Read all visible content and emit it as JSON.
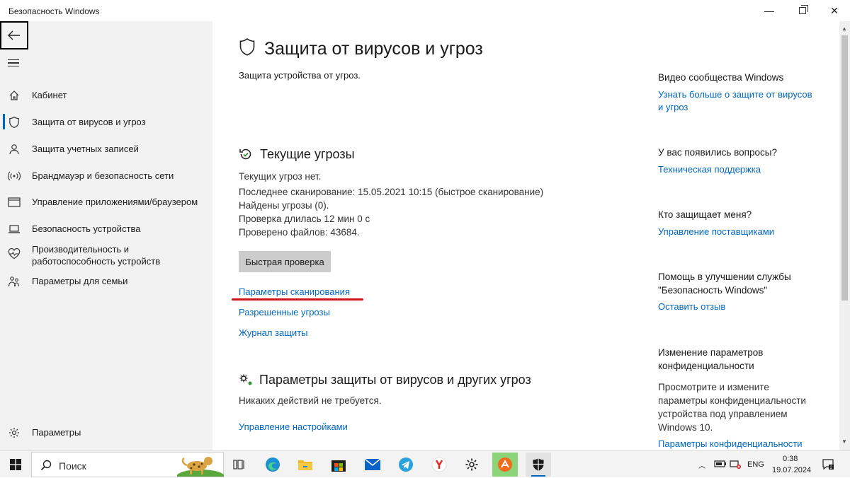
{
  "window": {
    "title": "Безопасность Windows",
    "minimize_glyph": "—",
    "close_glyph": "✕"
  },
  "sidebar": {
    "back_icon": "back-arrow-icon",
    "menu_icon": "hamburger-icon",
    "items": [
      {
        "label": "Кабинет",
        "icon": "home-icon"
      },
      {
        "label": "Защита от вирусов и угроз",
        "icon": "shield-icon",
        "active": true
      },
      {
        "label": "Защита учетных записей",
        "icon": "person-icon"
      },
      {
        "label": "Брандмауэр и безопасность сети",
        "icon": "wifi-icon"
      },
      {
        "label": "Управление приложениями/браузером",
        "icon": "app-window-icon"
      },
      {
        "label": "Безопасность устройства",
        "icon": "laptop-icon"
      },
      {
        "label": "Производительность и работоспособность устройств",
        "icon": "heart-icon"
      },
      {
        "label": "Параметры для семьи",
        "icon": "family-icon"
      }
    ],
    "settings_label": "Параметры"
  },
  "main": {
    "title": "Защита от вирусов и угроз",
    "subtitle": "Защита устройства от угроз.",
    "current_threats": {
      "title": "Текущие угрозы",
      "lines": [
        "Текущих угроз нет.",
        "Последнее сканирование: 15.05.2021 10:15 (быстрое сканирование)",
        "Найдены угрозы (0).",
        "Проверка длилась 12 мин 0 с",
        "Проверено файлов: 43684."
      ],
      "quick_scan_button": "Быстрая проверка",
      "links": [
        "Параметры сканирования",
        "Разрешенные угрозы",
        "Журнал защиты"
      ]
    },
    "protection_settings": {
      "title": "Параметры защиты от вирусов и других угроз",
      "status": "Никаких действий не требуется.",
      "link": "Управление настройками"
    }
  },
  "right_panel": {
    "community_title": "Видео сообщества Windows",
    "community_link": "Узнать больше о защите от вирусов и угроз",
    "questions_title": "У вас появились вопросы?",
    "questions_link": "Техническая поддержка",
    "who_title": "Кто защищает меня?",
    "who_link": "Управление поставщиками",
    "help_title": "Помощь в улучшении службы \"Безопасность Windows\"",
    "help_link": "Оставить отзыв",
    "privacy_title": "Изменение параметров конфиденциальности",
    "privacy_text": "Просмотрите и измените параметры конфиденциальности устройства под управлением Windows 10.",
    "privacy_link": "Параметры конфиденциальности"
  },
  "taskbar": {
    "search_placeholder": "Поиск",
    "apps": [
      "task-view-icon",
      "edge-icon",
      "file-explorer-icon",
      "microsoft-store-icon",
      "mail-icon",
      "telegram-icon",
      "yandex-browser-icon",
      "settings-gear-icon",
      "avast-icon",
      "windows-security-icon"
    ],
    "language": "ENG",
    "time": "0:38",
    "date": "19.07.2024"
  },
  "colors": {
    "accent": "#0067c0",
    "sidebar_bg": "#f2f2f2",
    "annotation_red": "#d0131b"
  }
}
